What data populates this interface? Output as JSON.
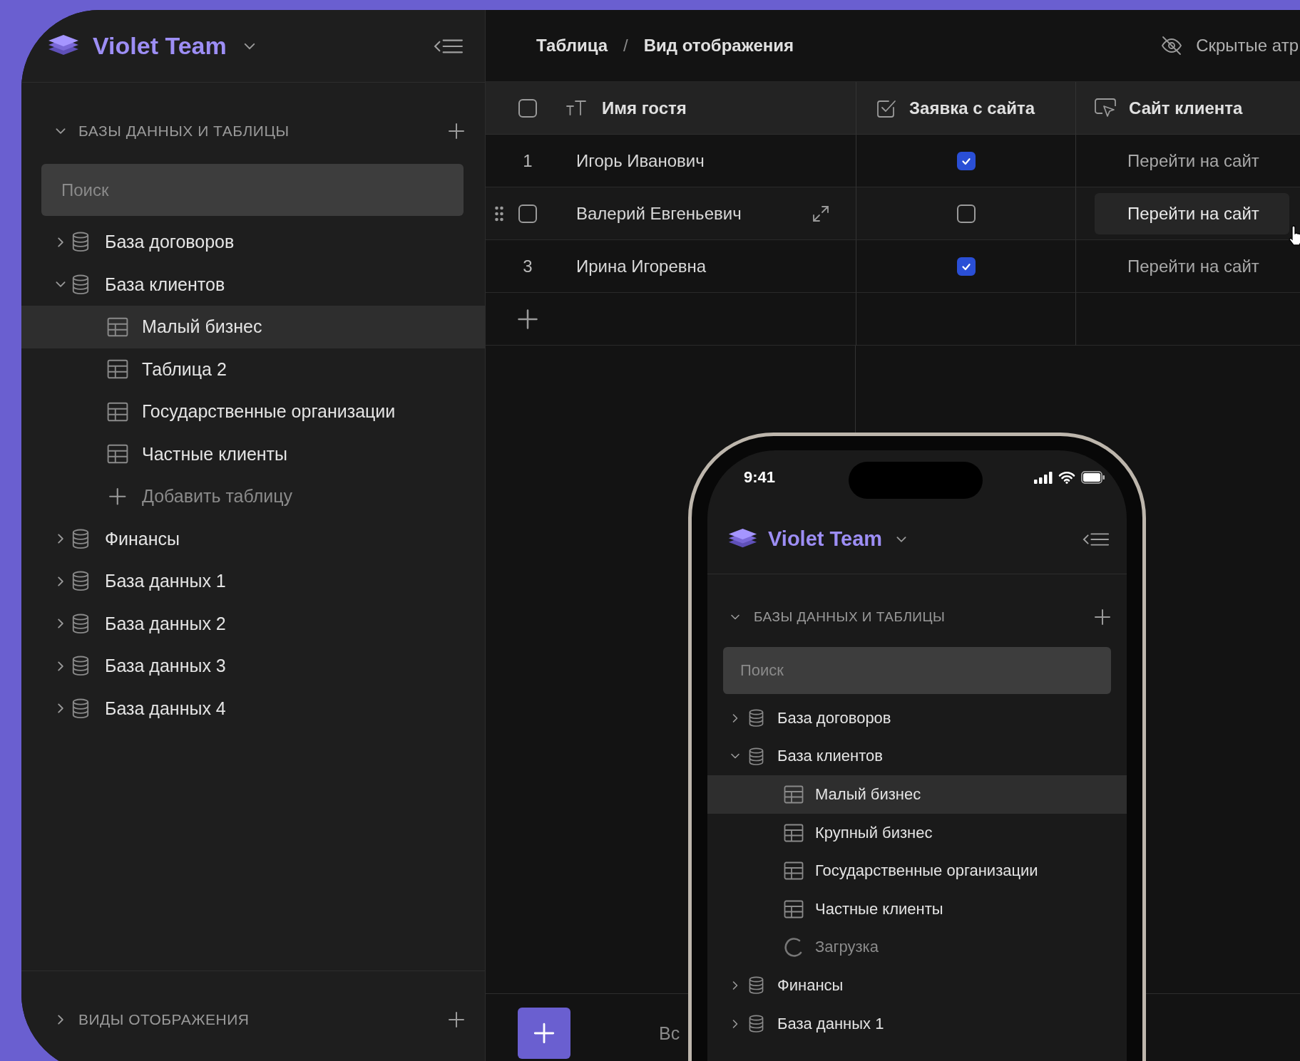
{
  "sidebar": {
    "workspace": "Violet Team",
    "section": {
      "title": "БАЗЫ ДАННЫХ И ТАБЛИЦЫ",
      "expanded": true
    },
    "search": {
      "placeholder": "Поиск"
    },
    "tree": [
      {
        "kind": "database",
        "label": "База договоров",
        "expanded": false,
        "selected": false
      },
      {
        "kind": "database",
        "label": "База клиентов",
        "expanded": true,
        "selected": false,
        "children": [
          {
            "kind": "table",
            "label": "Малый бизнес",
            "selected": true
          },
          {
            "kind": "table",
            "label": "Таблица 2",
            "selected": false
          },
          {
            "kind": "table",
            "label": "Государственные организации",
            "selected": false
          },
          {
            "kind": "table",
            "label": "Частные клиенты",
            "selected": false
          },
          {
            "kind": "add",
            "label": "Добавить таблицу",
            "selected": false
          }
        ]
      },
      {
        "kind": "database",
        "label": "Финансы",
        "expanded": false,
        "selected": false
      },
      {
        "kind": "database",
        "label": "База данных 1",
        "expanded": false,
        "selected": false
      },
      {
        "kind": "database",
        "label": "База данных 2",
        "expanded": false,
        "selected": false
      },
      {
        "kind": "database",
        "label": "База данных 3",
        "expanded": false,
        "selected": false
      },
      {
        "kind": "database",
        "label": "База данных 4",
        "expanded": false,
        "selected": false
      }
    ],
    "views": {
      "title": "ВИДЫ ОТОБРАЖЕНИЯ",
      "expanded": false
    }
  },
  "breadcrumb": [
    "Таблица",
    "Вид отображения"
  ],
  "breadcrumb_separator": "/",
  "hidden_attributes": "Скрытые атр",
  "table": {
    "select_all": false,
    "columns": [
      {
        "kind": "text",
        "label": "Имя гостя"
      },
      {
        "kind": "checkbox",
        "label": "Заявка с сайта"
      },
      {
        "kind": "link",
        "label": "Сайт клиента"
      }
    ],
    "rows": [
      {
        "number": "1",
        "name": "Игорь Иванович",
        "request": true,
        "link": "Перейти на сайт",
        "hovered": false,
        "selected": false
      },
      {
        "name": "Валерий Евгеньевич",
        "request": false,
        "link": "Перейти на сайт",
        "hovered": true,
        "selected": false
      },
      {
        "number": "3",
        "name": "Ирина Игоревна",
        "request": true,
        "link": "Перейти на сайт",
        "hovered": false,
        "selected": false
      }
    ]
  },
  "bottom_bar": {
    "filter": "Вс"
  },
  "phone": {
    "time": "9:41",
    "sidebar": {
      "workspace": "Violet Team",
      "section": {
        "title": "БАЗЫ ДАННЫХ И ТАБЛИЦЫ",
        "expanded": true
      },
      "search": {
        "placeholder": "Поиск"
      },
      "tree": [
        {
          "kind": "database",
          "label": "База договоров",
          "expanded": false,
          "selected": false
        },
        {
          "kind": "database",
          "label": "База клиентов",
          "expanded": true,
          "selected": false,
          "children": [
            {
              "kind": "table",
              "label": "Малый бизнес",
              "selected": true
            },
            {
              "kind": "table",
              "label": "Крупный бизнес",
              "selected": false
            },
            {
              "kind": "table",
              "label": "Государственные организации",
              "selected": false
            },
            {
              "kind": "table",
              "label": "Частные клиенты",
              "selected": false
            },
            {
              "kind": "loading",
              "label": "Загрузка",
              "selected": false
            }
          ]
        },
        {
          "kind": "database",
          "label": "Финансы",
          "expanded": false,
          "selected": false
        },
        {
          "kind": "database",
          "label": "База данных 1",
          "expanded": false,
          "selected": false
        }
      ]
    }
  }
}
